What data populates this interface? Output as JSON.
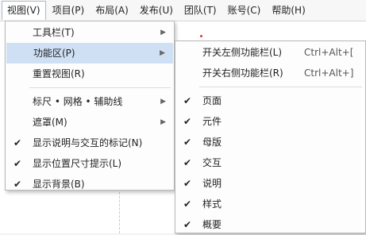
{
  "menubar": [
    {
      "label": "视图(V)",
      "active": true
    },
    {
      "label": "项目(P)"
    },
    {
      "label": "布局(A)"
    },
    {
      "label": "发布(U)"
    },
    {
      "label": "团队(T)"
    },
    {
      "label": "账号(C)"
    },
    {
      "label": "帮助(H)"
    }
  ],
  "view_menu": {
    "items": [
      {
        "label": "工具栏(T)",
        "submenu": true
      },
      {
        "label": "功能区(P)",
        "submenu": true,
        "highlighted": true
      },
      {
        "label": "重置视图(R)"
      },
      {
        "label": "标尺 • 网格 • 辅助线",
        "submenu": true
      },
      {
        "label": "遮罩(M)",
        "submenu": true
      },
      {
        "label": "显示说明与交互的标记(N)",
        "checked": true
      },
      {
        "label": "显示位置尺寸提示(L)",
        "checked": true
      },
      {
        "label": "显示背景(B)",
        "checked": true
      }
    ]
  },
  "ribbon_submenu": {
    "items": [
      {
        "label": "开关左侧功能栏(L)",
        "shortcut": "Ctrl+Alt+["
      },
      {
        "label": "开关右侧功能栏(R)",
        "shortcut": "Ctrl+Alt+]"
      },
      {
        "label": "页面",
        "checked": true
      },
      {
        "label": "元件",
        "checked": true
      },
      {
        "label": "母版",
        "checked": true
      },
      {
        "label": "交互",
        "checked": true
      },
      {
        "label": "说明",
        "checked": true
      },
      {
        "label": "样式",
        "checked": true
      },
      {
        "label": "概要",
        "checked": true
      }
    ]
  },
  "icons": {
    "check": "checkmark-icon",
    "submenu_arrow": "triangle-right-icon"
  },
  "colors": {
    "highlight": "#cfe0f5",
    "menu_bg": "#fdfdfd",
    "menubar_bg": "#f7f7f7"
  }
}
